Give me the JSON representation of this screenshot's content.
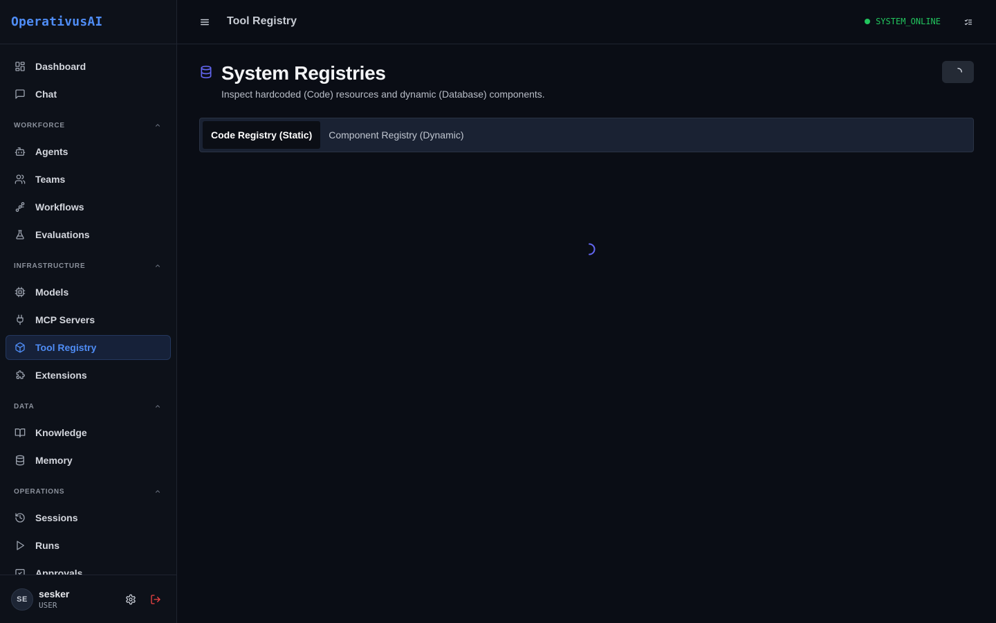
{
  "app": {
    "brand": "OperativusAI"
  },
  "sidebar": {
    "top_items": [
      {
        "label": "Dashboard",
        "icon": "dashboard-icon"
      },
      {
        "label": "Chat",
        "icon": "chat-icon"
      }
    ],
    "sections": [
      {
        "title": "WORKFORCE",
        "items": [
          {
            "label": "Agents",
            "icon": "bot-icon"
          },
          {
            "label": "Teams",
            "icon": "users-icon"
          },
          {
            "label": "Workflows",
            "icon": "workflow-icon"
          },
          {
            "label": "Evaluations",
            "icon": "flask-icon"
          }
        ]
      },
      {
        "title": "INFRASTRUCTURE",
        "items": [
          {
            "label": "Models",
            "icon": "cpu-icon"
          },
          {
            "label": "MCP Servers",
            "icon": "plug-icon"
          },
          {
            "label": "Tool Registry",
            "icon": "box-icon",
            "active": true
          },
          {
            "label": "Extensions",
            "icon": "puzzle-icon"
          }
        ]
      },
      {
        "title": "DATA",
        "items": [
          {
            "label": "Knowledge",
            "icon": "book-icon"
          },
          {
            "label": "Memory",
            "icon": "database-icon"
          }
        ]
      },
      {
        "title": "OPERATIONS",
        "items": [
          {
            "label": "Sessions",
            "icon": "history-icon"
          },
          {
            "label": "Runs",
            "icon": "play-icon"
          },
          {
            "label": "Approvals",
            "icon": "approval-icon"
          }
        ]
      }
    ],
    "user": {
      "initials": "SE",
      "name": "sesker",
      "role": "USER"
    }
  },
  "header": {
    "title": "Tool Registry",
    "status": "SYSTEM_ONLINE"
  },
  "main": {
    "title": "System Registries",
    "subtitle": "Inspect hardcoded (Code) resources and dynamic (Database) components.",
    "tabs": [
      {
        "label": "Code Registry (Static)",
        "active": true
      },
      {
        "label": "Component Registry (Dynamic)",
        "active": false
      }
    ]
  },
  "colors": {
    "accent": "#4f8df6",
    "status_online": "#22c55e",
    "page_icon": "#6366f1",
    "logout": "#ef4444"
  }
}
